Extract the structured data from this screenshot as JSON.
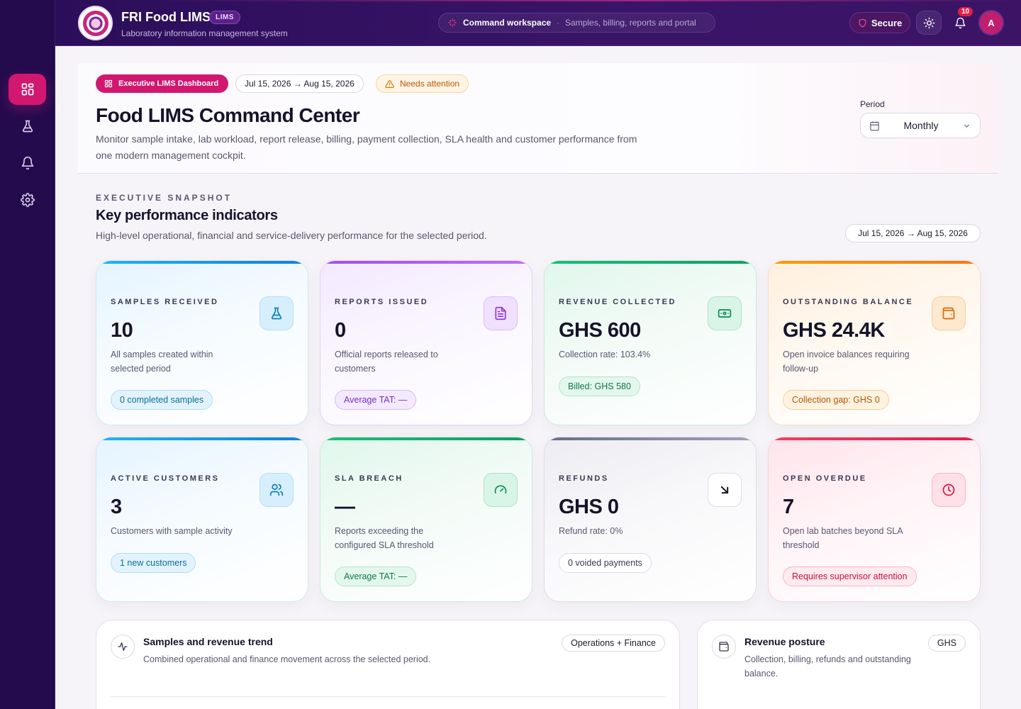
{
  "app": {
    "name": "FRI Food LIMS",
    "badge": "LIMS",
    "subtitle": "Laboratory information management system"
  },
  "workspace": {
    "title": "Command workspace",
    "separator": "·",
    "subtitle": "Samples, billing, reports and portal"
  },
  "header_actions": {
    "secure_label": "Secure",
    "notification_count": "10",
    "avatar_initial": "A"
  },
  "sidebar": {
    "items": [
      {
        "icon": "dashboard-icon",
        "active": true
      },
      {
        "icon": "flask-icon",
        "active": false
      },
      {
        "icon": "bell-icon",
        "active": false
      },
      {
        "icon": "gear-icon",
        "active": false
      }
    ]
  },
  "hero": {
    "primary_pill": "Executive LIMS Dashboard",
    "date_range": "Jul 15, 2026 → Aug 15, 2026",
    "warning_pill": "Needs attention",
    "title": "Food LIMS Command Center",
    "description": "Monitor sample intake, lab workload, report release, billing, payment collection, SLA health and customer performance from one modern management cockpit.",
    "period_label": "Period",
    "period_value": "Monthly"
  },
  "snapshot": {
    "eyebrow": "EXECUTIVE SNAPSHOT",
    "title": "Key performance indicators",
    "description": "High-level operational, financial and service-delivery performance for the selected period.",
    "date_range": "Jul 15, 2026 → Aug 15, 2026"
  },
  "kpis": [
    {
      "label": "SAMPLES RECEIVED",
      "value": "10",
      "desc": "All samples created within selected period",
      "chip": "0 completed samples",
      "icon": "flask-icon",
      "theme": "blue"
    },
    {
      "label": "REPORTS ISSUED",
      "value": "0",
      "desc": "Official reports released to customers",
      "chip": "Average TAT: —",
      "icon": "document-icon",
      "theme": "purple"
    },
    {
      "label": "REVENUE COLLECTED",
      "value": "GHS 600",
      "desc": "Collection rate: 103.4%",
      "chip": "Billed: GHS 580",
      "icon": "banknote-icon",
      "theme": "green"
    },
    {
      "label": "OUTSTANDING BALANCE",
      "value": "GHS 24.4K",
      "desc": "Open invoice balances requiring follow-up",
      "chip": "Collection gap: GHS 0",
      "icon": "wallet-icon",
      "theme": "orange"
    },
    {
      "label": "ACTIVE CUSTOMERS",
      "value": "3",
      "desc": "Customers with sample activity",
      "chip": "1 new customers",
      "icon": "users-icon",
      "theme": "blue"
    },
    {
      "label": "SLA BREACH",
      "value": "—",
      "desc": "Reports exceeding the configured SLA threshold",
      "chip": "Average TAT: —",
      "icon": "gauge-icon",
      "theme": "green"
    },
    {
      "label": "REFUNDS",
      "value": "GHS 0",
      "desc": "Refund rate: 0%",
      "chip": "0 voided payments",
      "icon": "arrow-down-right-icon",
      "theme": "gray"
    },
    {
      "label": "OPEN OVERDUE",
      "value": "7",
      "desc": "Open lab batches beyond SLA threshold",
      "chip": "Requires supervisor attention",
      "icon": "clock-icon",
      "theme": "pink"
    }
  ],
  "panels": {
    "trend": {
      "title": "Samples and revenue trend",
      "desc": "Combined operational and finance movement across the selected period.",
      "tag": "Operations + Finance"
    },
    "revenue": {
      "title": "Revenue posture",
      "desc": "Collection, billing, refunds and outstanding balance.",
      "tag": "GHS"
    }
  },
  "colors": {
    "sidebar_bg": "#240b4e",
    "topbar_bg": "#2b0e5a",
    "accent": "#d1176f",
    "warning": "#b45a06"
  }
}
